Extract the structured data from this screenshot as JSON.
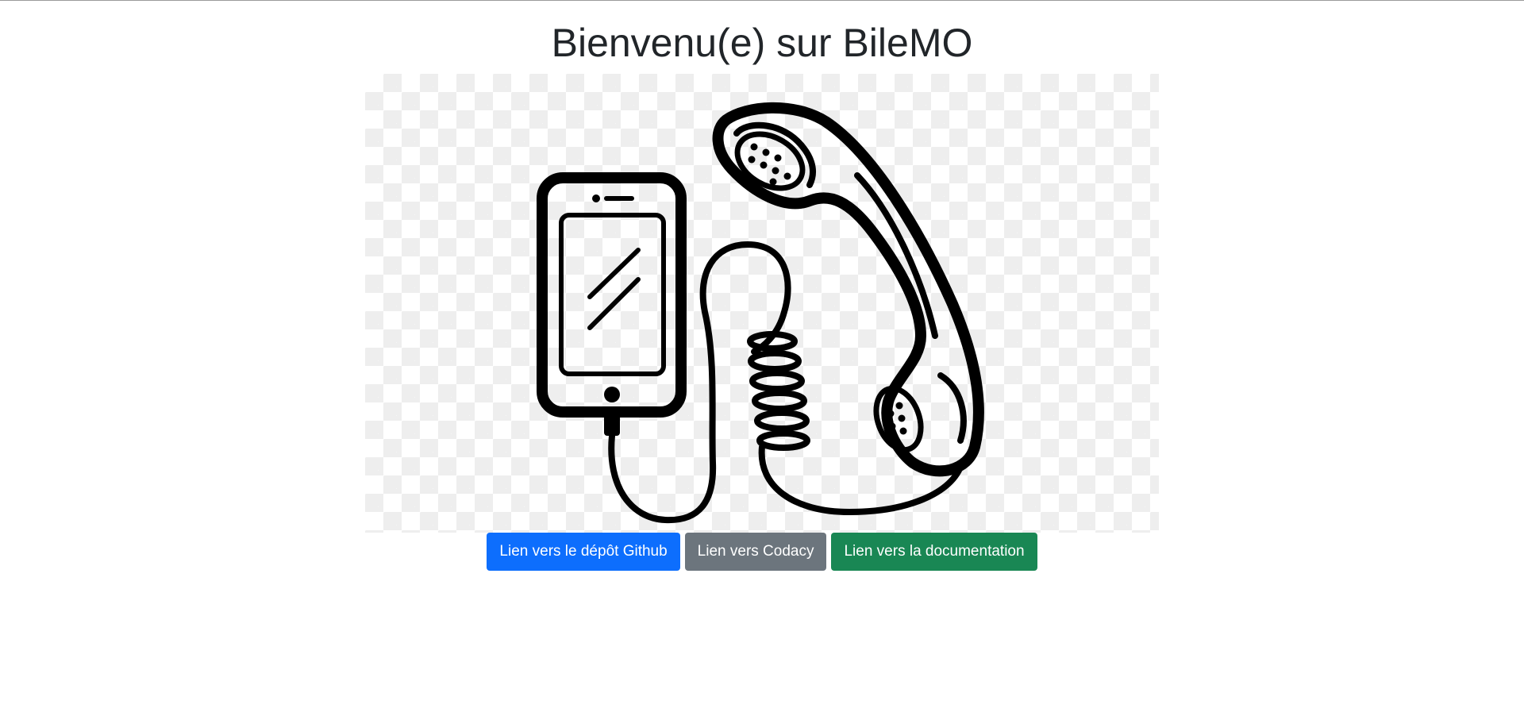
{
  "page": {
    "title": "Bienvenu(e) sur BileMO"
  },
  "hero": {
    "image": "phone-with-coiled-handset-illustration"
  },
  "buttons": [
    {
      "label": "Lien vers le dépôt Github",
      "color": "#0d6efd"
    },
    {
      "label": "Lien vers Codacy",
      "color": "#6c757d"
    },
    {
      "label": "Lien vers la documentation",
      "color": "#198754"
    }
  ]
}
